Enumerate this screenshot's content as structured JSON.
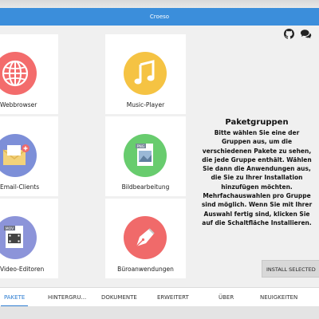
{
  "window": {
    "title": "Croeso"
  },
  "top_icons": [
    "github-icon",
    "chat-icon"
  ],
  "tiles": [
    {
      "label": "Webbrowser",
      "icon": "globe-icon",
      "color": "#f36c6c"
    },
    {
      "label": "Music-Player",
      "icon": "music-note-icon",
      "color": "#f5c343"
    },
    {
      "label": "Email-Clients",
      "icon": "envelope-icon",
      "color": "#7d8fd8"
    },
    {
      "label": "Bildbearbeitung",
      "icon": "image-file-icon",
      "color": "#68cc6e"
    },
    {
      "label": "Video-Editoren",
      "icon": "movie-file-icon",
      "color": "#8c94d9"
    },
    {
      "label": "Büroanwendungen",
      "icon": "pen-nib-icon",
      "color": "#f06a6a"
    }
  ],
  "description": {
    "heading": "Paketgruppen",
    "lines": [
      "Bitte wählen Sie eine der",
      "Gruppen aus, um die",
      "verschiedenen Pakete zu sehen,",
      "die jede Gruppe enthält. Wählen",
      "Sie dann die Anwendungen aus,",
      "die Sie zu Ihrer Installation",
      "hinzufügen möchten.",
      "Mehrfachauswahlen pro Gruppe",
      "sind möglich. Wenn Sie mit Ihrer",
      "Auswahl fertig sind, klicken Sie",
      "auf die Schaltfläche Installieren."
    ]
  },
  "install_button": "INSTALL SELECTED",
  "tabs": [
    "PAKETE",
    "HINTERGRU...",
    "DOKUMENTE",
    "ERWEITERT",
    "ÜBER",
    "NEUIGKEITEN"
  ],
  "active_tab": "PAKETE"
}
